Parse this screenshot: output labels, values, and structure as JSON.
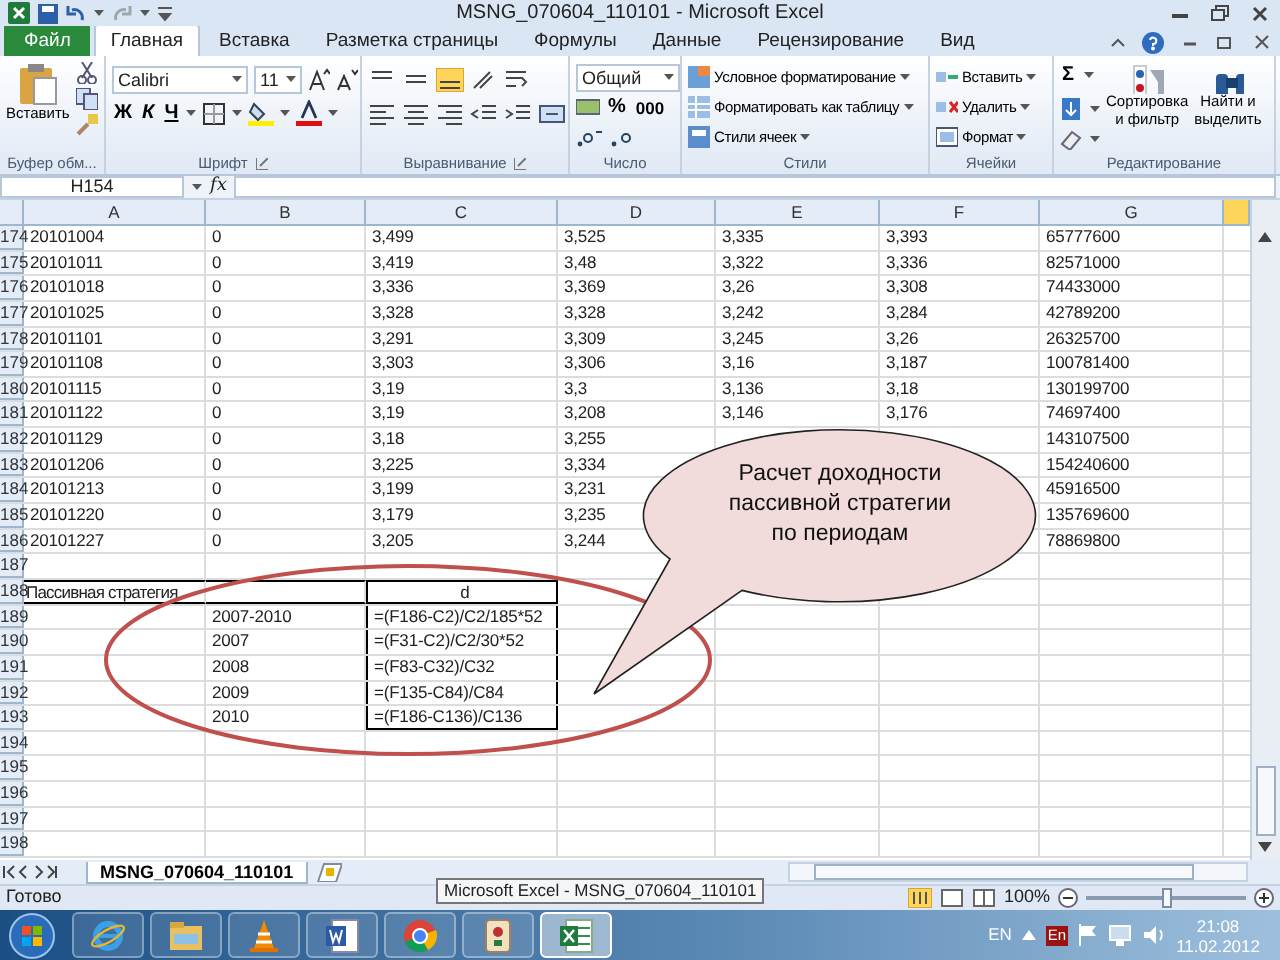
{
  "window": {
    "title": "MSNG_070604_110101 - Microsoft Excel"
  },
  "ribbon_tabs": [
    {
      "label": "Файл",
      "kind": "file",
      "selected": false
    },
    {
      "label": "Главная",
      "kind": "tab",
      "selected": true
    },
    {
      "label": "Вставка",
      "kind": "tab",
      "selected": false
    },
    {
      "label": "Разметка страницы",
      "kind": "tab",
      "selected": false
    },
    {
      "label": "Формулы",
      "kind": "tab",
      "selected": false
    },
    {
      "label": "Данные",
      "kind": "tab",
      "selected": false
    },
    {
      "label": "Рецензирование",
      "kind": "tab",
      "selected": false
    },
    {
      "label": "Вид",
      "kind": "tab",
      "selected": false
    }
  ],
  "ribbon": {
    "clipboard": {
      "label": "Буфер обм...",
      "paste": "Вставить"
    },
    "font": {
      "label": "Шрифт",
      "name": "Calibri",
      "size": "11",
      "bold": "Ж",
      "italic": "К",
      "underline": "Ч"
    },
    "alignment": {
      "label": "Выравнивание"
    },
    "number": {
      "label": "Число",
      "format": "Общий",
      "percent": "%",
      "thousands": "000"
    },
    "styles": {
      "label": "Стили",
      "items": [
        "Условное форматирование",
        "Форматировать как таблицу",
        "Стили ячеек"
      ]
    },
    "cells": {
      "label": "Ячейки",
      "items": [
        "Вставить",
        "Удалить",
        "Формат"
      ]
    },
    "editing": {
      "label": "Редактирование",
      "sum": "Σ",
      "sort": [
        "Сортировка",
        "и фильтр"
      ],
      "find": [
        "Найти и",
        "выделить"
      ]
    }
  },
  "formula_bar": {
    "name_box": "H154",
    "fx": "fx"
  },
  "sheet": {
    "columns": [
      "A",
      "B",
      "C",
      "D",
      "E",
      "F",
      "G"
    ],
    "rows": [
      {
        "number": "174",
        "cells": {
          "A": "20101004",
          "B": "0",
          "C": "3,499",
          "D": "3,525",
          "E": "3,335",
          "F": "3,393",
          "G": "65777600"
        }
      },
      {
        "number": "175",
        "cells": {
          "A": "20101011",
          "B": "0",
          "C": "3,419",
          "D": "3,48",
          "E": "3,322",
          "F": "3,336",
          "G": "82571000"
        }
      },
      {
        "number": "176",
        "cells": {
          "A": "20101018",
          "B": "0",
          "C": "3,336",
          "D": "3,369",
          "E": "3,26",
          "F": "3,308",
          "G": "74433000"
        }
      },
      {
        "number": "177",
        "cells": {
          "A": "20101025",
          "B": "0",
          "C": "3,328",
          "D": "3,328",
          "E": "3,242",
          "F": "3,284",
          "G": "42789200"
        }
      },
      {
        "number": "178",
        "cells": {
          "A": "20101101",
          "B": "0",
          "C": "3,291",
          "D": "3,309",
          "E": "3,245",
          "F": "3,26",
          "G": "26325700"
        }
      },
      {
        "number": "179",
        "cells": {
          "A": "20101108",
          "B": "0",
          "C": "3,303",
          "D": "3,306",
          "E": "3,16",
          "F": "3,187",
          "G": "100781400"
        }
      },
      {
        "number": "180",
        "cells": {
          "A": "20101115",
          "B": "0",
          "C": "3,19",
          "D": "3,3",
          "E": "3,136",
          "F": "3,18",
          "G": "130199700"
        }
      },
      {
        "number": "181",
        "cells": {
          "A": "20101122",
          "B": "0",
          "C": "3,19",
          "D": "3,208",
          "E": "3,146",
          "F": "3,176",
          "G": "74697400"
        }
      },
      {
        "number": "182",
        "cells": {
          "A": "20101129",
          "B": "0",
          "C": "3,18",
          "D": "3,255",
          "G": "143107500"
        }
      },
      {
        "number": "183",
        "cells": {
          "A": "20101206",
          "B": "0",
          "C": "3,225",
          "D": "3,334",
          "G": "154240600"
        }
      },
      {
        "number": "184",
        "cells": {
          "A": "20101213",
          "B": "0",
          "C": "3,199",
          "D": "3,231",
          "G": "45916500"
        }
      },
      {
        "number": "185",
        "cells": {
          "A": "20101220",
          "B": "0",
          "C": "3,179",
          "D": "3,235",
          "G": "135769600"
        }
      },
      {
        "number": "186",
        "cells": {
          "A": "20101227",
          "B": "0",
          "C": "3,205",
          "D": "3,244",
          "G": "78869800"
        }
      },
      {
        "number": "187",
        "cells": {}
      },
      {
        "number": "188",
        "kind": "box-header",
        "cells": {
          "A": "Пассивная стратегия",
          "C": "d"
        }
      },
      {
        "number": "189",
        "kind": "box",
        "cells": {
          "B": "2007-2010",
          "C": "=(F186-C2)/C2/185*52"
        }
      },
      {
        "number": "190",
        "kind": "box",
        "cells": {
          "B": "2007",
          "C": "=(F31-C2)/C2/30*52"
        }
      },
      {
        "number": "191",
        "kind": "box",
        "cells": {
          "B": "2008",
          "C": "=(F83-C32)/C32"
        }
      },
      {
        "number": "192",
        "kind": "box",
        "cells": {
          "B": "2009",
          "C": "=(F135-C84)/C84"
        }
      },
      {
        "number": "193",
        "kind": "box-end",
        "cells": {
          "B": "2010",
          "C": "=(F186-C136)/C136"
        }
      },
      {
        "number": "194",
        "cells": {}
      },
      {
        "number": "195",
        "cells": {}
      },
      {
        "number": "196",
        "cells": {}
      },
      {
        "number": "197",
        "cells": {}
      },
      {
        "number": "198",
        "cells": {}
      }
    ]
  },
  "callout": {
    "lines": [
      "Расчет доходности",
      "пассивной стратегии",
      "по периодам"
    ]
  },
  "sheet_tabs": [
    {
      "label": "MSNG_070604_110101",
      "selected": true
    }
  ],
  "status_bar": {
    "text": "Готово",
    "zoom": "100%",
    "zoom_slider": {
      "level": 0.5
    }
  },
  "taskbar": {
    "apps": [
      {
        "kind": "ie",
        "selected": false
      },
      {
        "kind": "folder",
        "selected": false
      },
      {
        "kind": "vlc",
        "selected": false
      },
      {
        "kind": "word",
        "selected": false
      },
      {
        "kind": "chrome",
        "selected": false
      },
      {
        "kind": "mahjong",
        "selected": false
      },
      {
        "kind": "excel",
        "selected": true
      }
    ],
    "tooltip": "Microsoft Excel - MSNG_070604_110101",
    "language": "EN",
    "input_indicator": "En",
    "time": "21:08",
    "date": "11.02.2012"
  }
}
